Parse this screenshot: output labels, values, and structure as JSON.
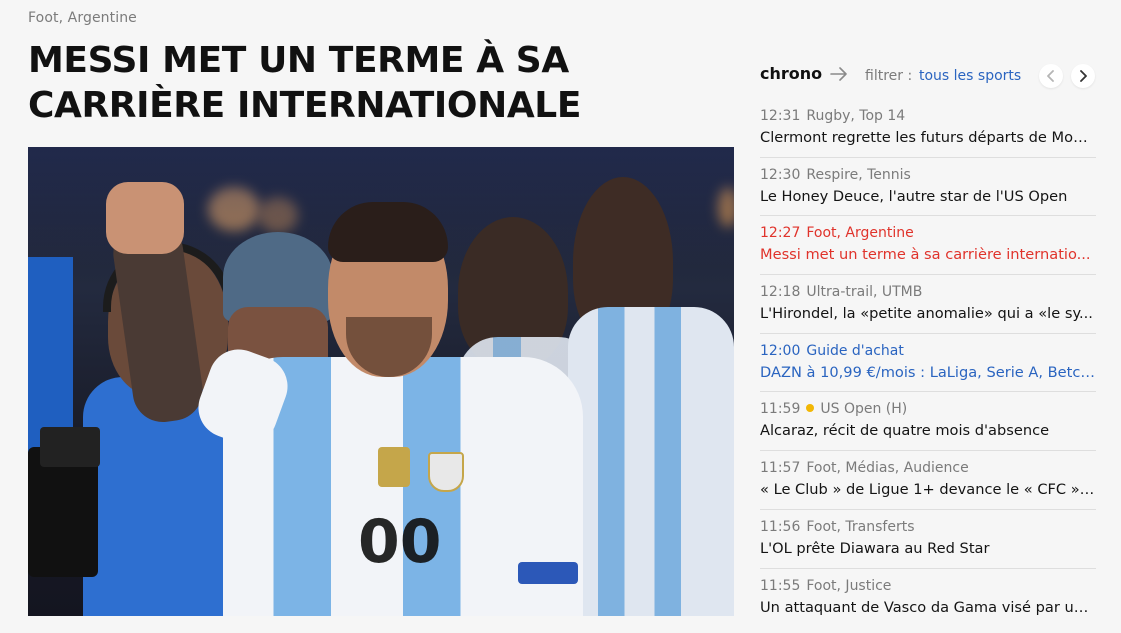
{
  "article": {
    "kicker": "Foot, Argentine",
    "headline": "MESSI MET UN TERME À SA CARRIÈRE INTERNATIONALE"
  },
  "chrono": {
    "title": "chrono",
    "filter_label": "filtrer :",
    "filter_value": "tous les sports",
    "arrow_icon": "arrow-right-icon",
    "prev_icon": "chevron-left-icon",
    "next_icon": "chevron-right-icon",
    "items": [
      {
        "time": "12:31",
        "category": "Rugby, Top 14",
        "title": "Clermont regrette les futurs départs de Mon...",
        "state": "normal"
      },
      {
        "time": "12:30",
        "category": "Respire, Tennis",
        "title": "Le Honey Deuce, l'autre star de l'US Open",
        "state": "normal"
      },
      {
        "time": "12:27",
        "category": "Foot, Argentine",
        "title": "Messi met un terme à sa carrière internatio...",
        "state": "active"
      },
      {
        "time": "12:18",
        "category": "Ultra-trail, UTMB",
        "title": "L'Hirondel, la «petite anomalie» qui a «le sy...",
        "state": "normal"
      },
      {
        "time": "12:00",
        "category": "Guide d'achat",
        "title": "DAZN à 10,99 €/mois : LaLiga, Serie A, Betcl...",
        "state": "promo"
      },
      {
        "time": "11:59",
        "category": "US Open (H)",
        "title": "Alcaraz, récit de quatre mois d'absence",
        "state": "live"
      },
      {
        "time": "11:57",
        "category": "Foot, Médias, Audience",
        "title": "« Le Club » de Ligue 1+ devance le « CFC » ...",
        "state": "normal"
      },
      {
        "time": "11:56",
        "category": "Foot, Transferts",
        "title": "L'OL prête Diawara au Red Star",
        "state": "normal"
      },
      {
        "time": "11:55",
        "category": "Foot, Justice",
        "title": "Un attaquant de Vasco da Gama visé par un...",
        "state": "normal"
      }
    ]
  },
  "colors": {
    "accent_red": "#e0332b",
    "link_blue": "#2a64c0",
    "live_dot": "#f2b705"
  }
}
